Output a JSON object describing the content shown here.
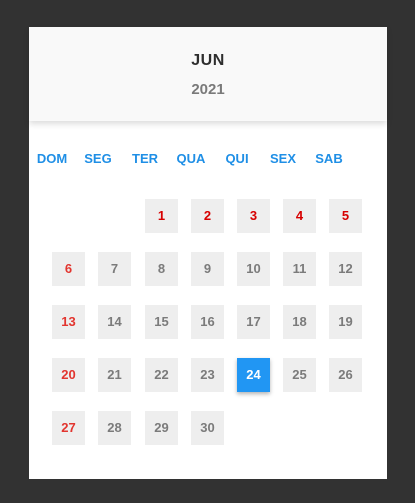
{
  "header": {
    "month": "JUN",
    "year": "2021"
  },
  "weekdays": [
    "DOM",
    "SEG",
    "TER",
    "QUA",
    "QUI",
    "SEX",
    "SAB"
  ],
  "days": [
    {
      "label": "1",
      "row": 0,
      "col": 2,
      "style": "holiday"
    },
    {
      "label": "2",
      "row": 0,
      "col": 3,
      "style": "holiday"
    },
    {
      "label": "3",
      "row": 0,
      "col": 4,
      "style": "holiday"
    },
    {
      "label": "4",
      "row": 0,
      "col": 5,
      "style": "holiday"
    },
    {
      "label": "5",
      "row": 0,
      "col": 6,
      "style": "holiday"
    },
    {
      "label": "6",
      "row": 1,
      "col": 0,
      "style": "weekend"
    },
    {
      "label": "7",
      "row": 1,
      "col": 1,
      "style": "normal"
    },
    {
      "label": "8",
      "row": 1,
      "col": 2,
      "style": "normal"
    },
    {
      "label": "9",
      "row": 1,
      "col": 3,
      "style": "normal"
    },
    {
      "label": "10",
      "row": 1,
      "col": 4,
      "style": "normal"
    },
    {
      "label": "11",
      "row": 1,
      "col": 5,
      "style": "normal"
    },
    {
      "label": "12",
      "row": 1,
      "col": 6,
      "style": "normal"
    },
    {
      "label": "13",
      "row": 2,
      "col": 0,
      "style": "weekend"
    },
    {
      "label": "14",
      "row": 2,
      "col": 1,
      "style": "normal"
    },
    {
      "label": "15",
      "row": 2,
      "col": 2,
      "style": "normal"
    },
    {
      "label": "16",
      "row": 2,
      "col": 3,
      "style": "normal"
    },
    {
      "label": "17",
      "row": 2,
      "col": 4,
      "style": "normal"
    },
    {
      "label": "18",
      "row": 2,
      "col": 5,
      "style": "normal"
    },
    {
      "label": "19",
      "row": 2,
      "col": 6,
      "style": "normal"
    },
    {
      "label": "20",
      "row": 3,
      "col": 0,
      "style": "weekend"
    },
    {
      "label": "21",
      "row": 3,
      "col": 1,
      "style": "normal"
    },
    {
      "label": "22",
      "row": 3,
      "col": 2,
      "style": "normal"
    },
    {
      "label": "23",
      "row": 3,
      "col": 3,
      "style": "normal"
    },
    {
      "label": "24",
      "row": 3,
      "col": 4,
      "style": "selected"
    },
    {
      "label": "25",
      "row": 3,
      "col": 5,
      "style": "normal"
    },
    {
      "label": "26",
      "row": 3,
      "col": 6,
      "style": "normal"
    },
    {
      "label": "27",
      "row": 4,
      "col": 0,
      "style": "weekend"
    },
    {
      "label": "28",
      "row": 4,
      "col": 1,
      "style": "normal"
    },
    {
      "label": "29",
      "row": 4,
      "col": 2,
      "style": "normal"
    },
    {
      "label": "30",
      "row": 4,
      "col": 3,
      "style": "normal"
    }
  ],
  "colors": {
    "accent": "#2196f3",
    "weekday_header": "#1f8fe6",
    "weekend": "#e2352f",
    "holiday": "#d70000",
    "day_text": "#7b7b7b",
    "day_bg": "#eeeeee",
    "background": "#323232"
  }
}
